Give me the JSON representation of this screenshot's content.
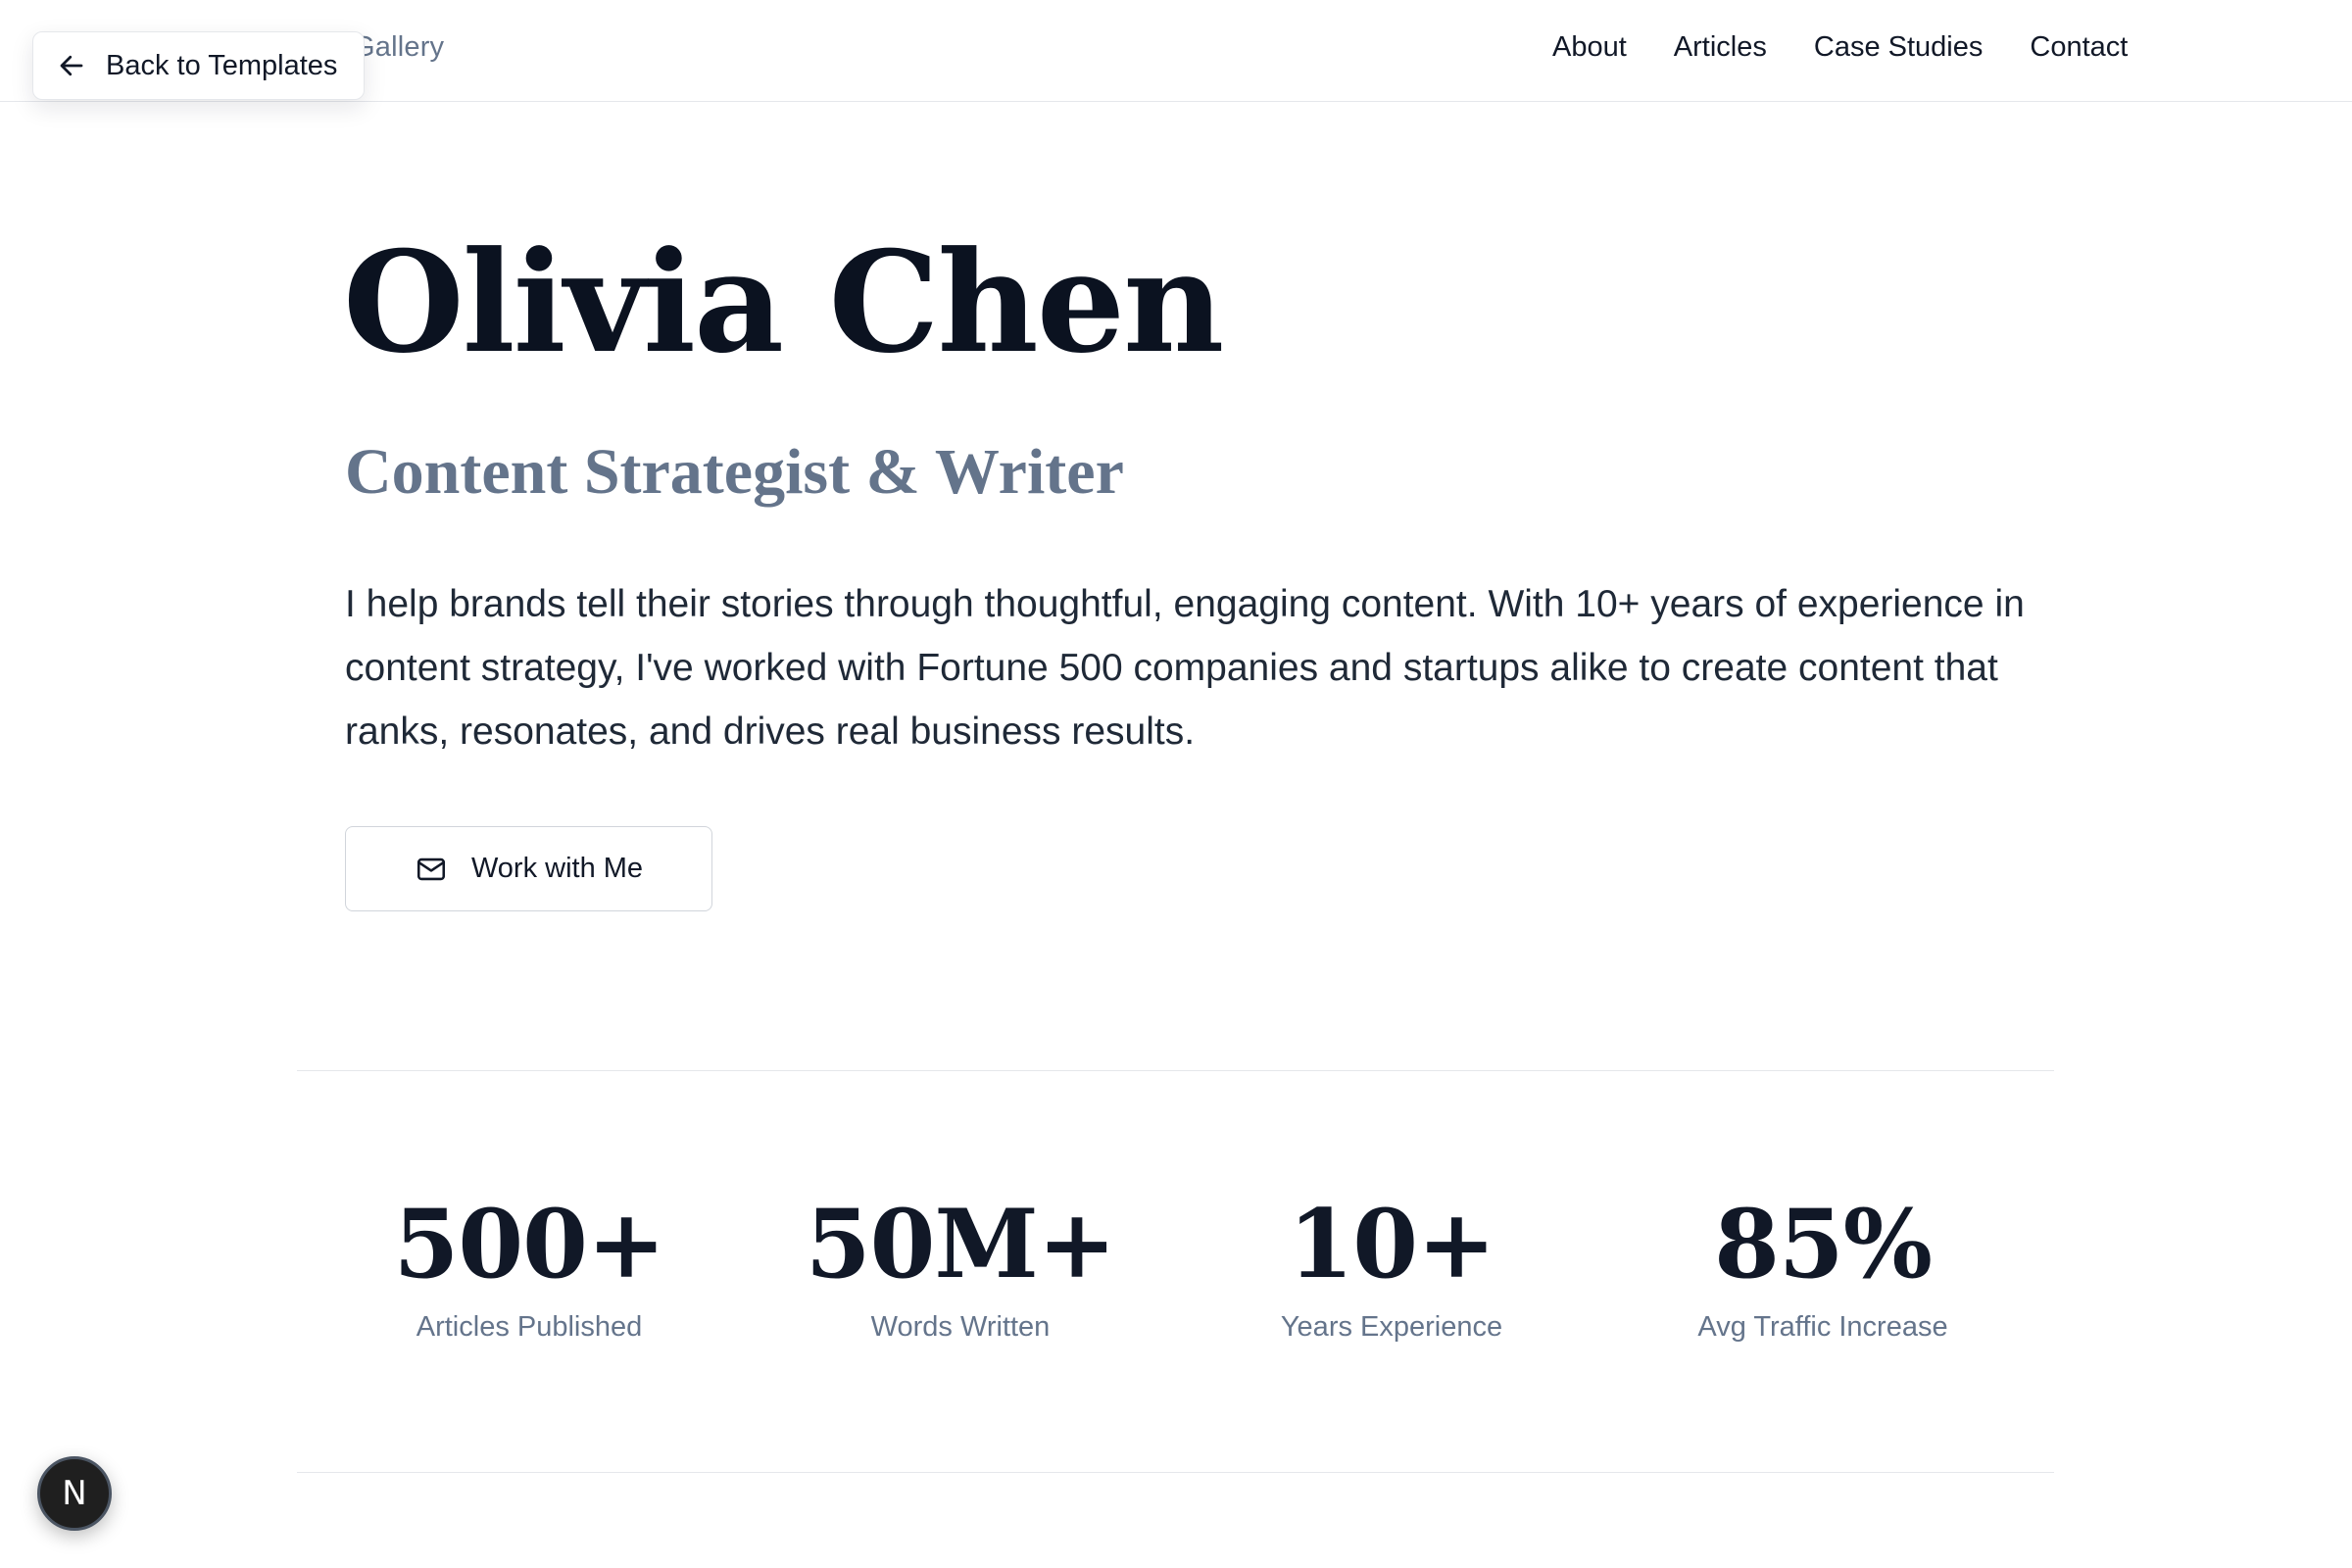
{
  "header": {
    "brand": "Gallery",
    "nav": [
      {
        "label": "About"
      },
      {
        "label": "Articles"
      },
      {
        "label": "Case Studies"
      },
      {
        "label": "Contact"
      }
    ],
    "back_button": {
      "label": "Back to Templates",
      "icon": "arrow-left-icon"
    }
  },
  "hero": {
    "name": "Olivia Chen",
    "role": "Content Strategist & Writer",
    "bio": "I help brands tell their stories through thoughtful, engaging content. With 10+ years of experience in content strategy, I've worked with Fortune 500 companies and startups alike to create content that ranks, resonates, and drives real business results.",
    "cta": {
      "label": "Work with Me",
      "icon": "mail-icon"
    }
  },
  "stats": [
    {
      "value": "500+",
      "label": "Articles Published"
    },
    {
      "value": "50M+",
      "label": "Words Written"
    },
    {
      "value": "10+",
      "label": "Years Experience"
    },
    {
      "value": "85%",
      "label": "Avg Traffic Increase"
    }
  ],
  "badge": {
    "letter": "N"
  },
  "colors": {
    "text_primary": "#0b1220",
    "text_muted": "#64748b",
    "border": "#e5e7eb",
    "badge_bg": "#1f1f1f"
  }
}
